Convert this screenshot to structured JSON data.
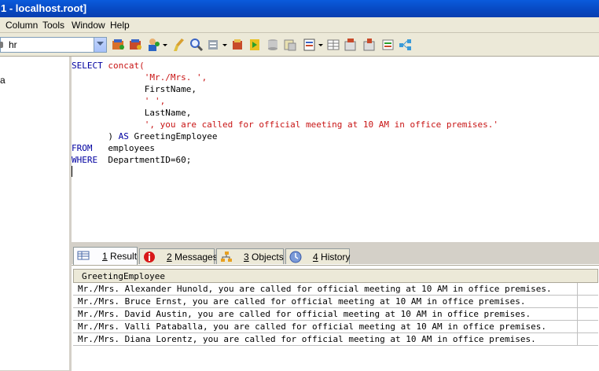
{
  "window": {
    "title": "1 - localhost.root]"
  },
  "menu": {
    "items": [
      "Column",
      "Tools",
      "Window",
      "Help"
    ]
  },
  "toolbar": {
    "database_value": "hr",
    "icons": [
      "execute-query-icon",
      "execute-all-icon",
      "user-manager-icon",
      "clear-icon",
      "search-icon",
      "schema-designer-icon",
      "import-icon",
      "export-icon",
      "copy-database-icon",
      "sync-icon",
      "backup-icon",
      "table-icon",
      "grid-view-icon",
      "data-sync-icon",
      "job-agent-icon",
      "notification-icon",
      "visual-diff-icon"
    ]
  },
  "left_pane": {
    "tree_fragment": "a"
  },
  "editor": {
    "lines": [
      [
        {
          "t": "SELECT ",
          "c": "kw"
        },
        {
          "t": "concat(",
          "c": "fn"
        }
      ],
      [
        {
          "t": "              'Mr./Mrs. ',",
          "c": "str"
        }
      ],
      [
        {
          "t": "              FirstName,",
          "c": "plain"
        }
      ],
      [
        {
          "t": "              ' ',",
          "c": "str"
        }
      ],
      [
        {
          "t": "              LastName,",
          "c": "plain"
        }
      ],
      [
        {
          "t": "              ', you are called for official meeting at 10 AM in office premises.'",
          "c": "str"
        }
      ],
      [
        {
          "t": "       ) ",
          "c": "plain"
        },
        {
          "t": "AS",
          "c": "kw"
        },
        {
          "t": " GreetingEmployee",
          "c": "plain"
        }
      ],
      [
        {
          "t": "FROM",
          "c": "kw"
        },
        {
          "t": "   employees",
          "c": "plain"
        }
      ],
      [
        {
          "t": "WHERE",
          "c": "kw"
        },
        {
          "t": "  DepartmentID=60;",
          "c": "plain"
        }
      ]
    ]
  },
  "tabs": [
    {
      "num": "1",
      "label": " Result",
      "icon": "grid-icon",
      "active": true
    },
    {
      "num": "2",
      "label": " Messages",
      "icon": "info-icon",
      "active": false
    },
    {
      "num": "3",
      "label": " Objects",
      "icon": "objects-icon",
      "active": false
    },
    {
      "num": "4",
      "label": " History",
      "icon": "history-icon",
      "active": false
    }
  ],
  "results": {
    "column": "GreetingEmployee",
    "rows": [
      "Mr./Mrs. Alexander Hunold, you are called for official meeting at 10 AM in office premises.",
      "Mr./Mrs. Bruce Ernst, you are called for official meeting at 10 AM in office premises.",
      "Mr./Mrs. David Austin, you are called for official meeting at 10 AM in office premises.",
      "Mr./Mrs. Valli Pataballa, you are called for official meeting at 10 AM in office premises.",
      "Mr./Mrs. Diana Lorentz, you are called for official meeting at 10 AM in office premises."
    ]
  },
  "colors": {
    "keyword": "#0000a0",
    "string": "#c81414",
    "titlebar": "#0747c0"
  }
}
